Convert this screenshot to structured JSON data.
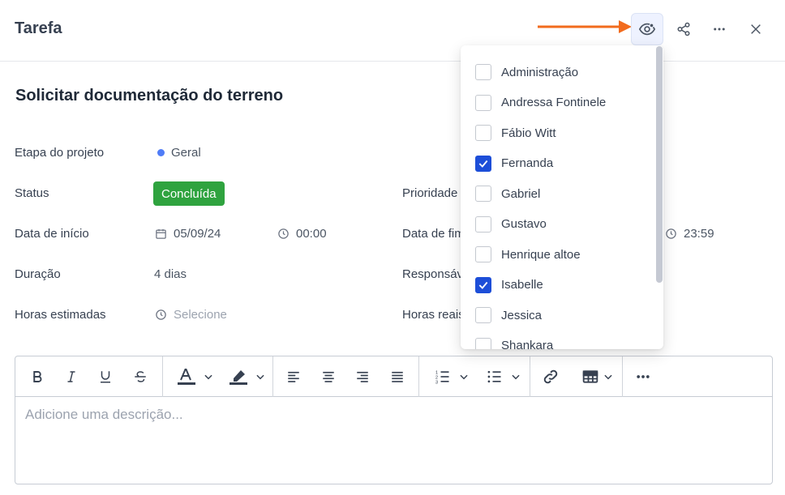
{
  "header": {
    "title": "Tarefa"
  },
  "icons": {
    "watch": "eye-icon",
    "share": "share-icon",
    "more": "more-horizontal-icon",
    "close": "close-icon"
  },
  "colors": {
    "accent": "#1d4ed8",
    "status_done": "#2fa33f",
    "arrow": "#f26b1d",
    "stage_dot": "#4f7cf7"
  },
  "task": {
    "title": "Solicitar documentação do terreno",
    "stage_label": "Etapa do projeto",
    "stage_value": "Geral",
    "status_label": "Status",
    "status_value": "Concluída",
    "priority_label": "Prioridade",
    "start_label": "Data de início",
    "start_date": "05/09/24",
    "start_time": "00:00",
    "end_label": "Data de fim",
    "end_time": "23:59",
    "duration_label": "Duração",
    "duration_value": "4 dias",
    "responsible_label": "Responsável",
    "est_hours_label": "Horas estimadas",
    "est_hours_placeholder": "Selecione",
    "real_hours_label": "Horas reais"
  },
  "editor": {
    "placeholder": "Adicione uma descrição..."
  },
  "watchers": [
    {
      "name": "Administração",
      "checked": false
    },
    {
      "name": "Andressa Fontinele",
      "checked": false
    },
    {
      "name": "Fábio Witt",
      "checked": false
    },
    {
      "name": "Fernanda",
      "checked": true
    },
    {
      "name": "Gabriel",
      "checked": false
    },
    {
      "name": "Gustavo",
      "checked": false
    },
    {
      "name": "Henrique altoe",
      "checked": false
    },
    {
      "name": "Isabelle",
      "checked": true
    },
    {
      "name": "Jessica",
      "checked": false
    },
    {
      "name": "Shankara",
      "checked": false
    }
  ]
}
